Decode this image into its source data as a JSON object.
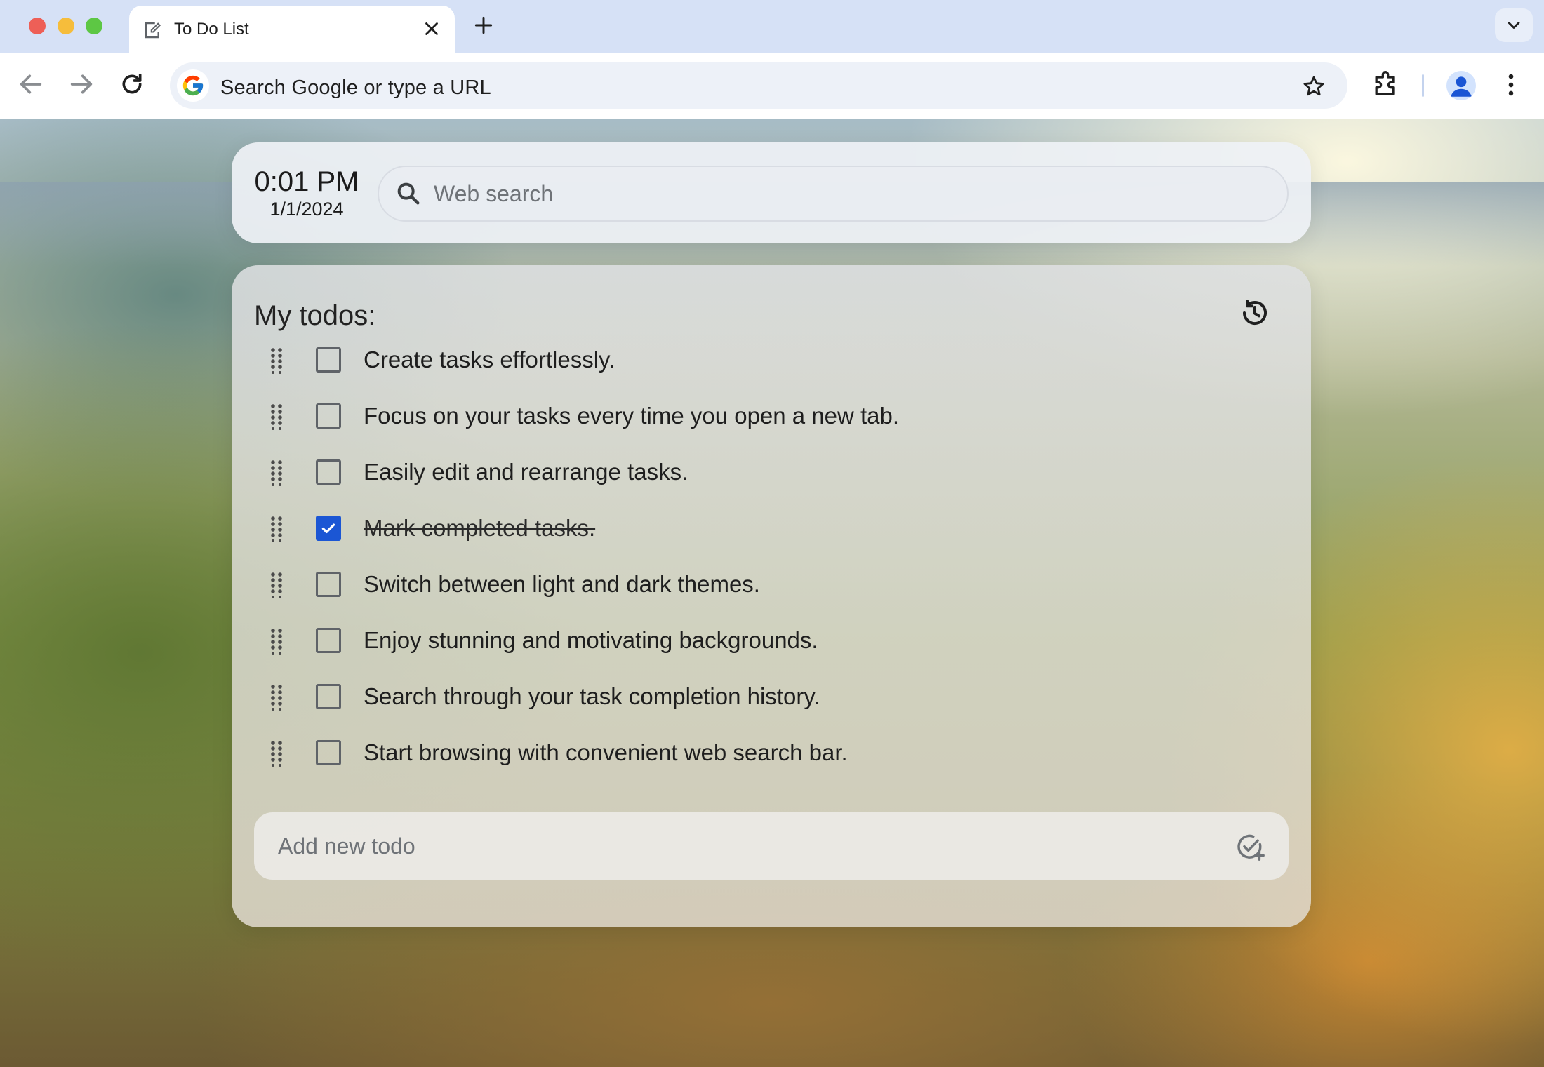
{
  "browser": {
    "tab_title": "To Do List",
    "omnibox_placeholder": "Search Google or type a URL"
  },
  "header": {
    "time": "0:01 PM",
    "date": "1/1/2024",
    "search_placeholder": "Web search"
  },
  "todos": {
    "title": "My todos:",
    "items": [
      {
        "text": "Create tasks effortlessly.",
        "done": false
      },
      {
        "text": "Focus on your tasks every time you open a new tab.",
        "done": false
      },
      {
        "text": "Easily edit and rearrange tasks.",
        "done": false
      },
      {
        "text": "Mark completed tasks.",
        "done": true
      },
      {
        "text": "Switch between light and dark themes.",
        "done": false
      },
      {
        "text": "Enjoy stunning and motivating backgrounds.",
        "done": false
      },
      {
        "text": "Search through your task completion history.",
        "done": false
      },
      {
        "text": "Start browsing with convenient web search bar.",
        "done": false
      }
    ],
    "add_placeholder": "Add new todo"
  },
  "colors": {
    "checkbox_checked": "#1b56d4",
    "tabstrip": "#d6e1f6"
  },
  "icons": [
    "edit-note-icon",
    "close-icon",
    "plus-icon",
    "chevron-down-icon",
    "back-arrow-icon",
    "forward-arrow-icon",
    "reload-icon",
    "google-logo-icon",
    "star-icon",
    "extensions-puzzle-icon",
    "profile-avatar-icon",
    "kebab-menu-icon",
    "search-icon",
    "history-icon",
    "drag-handle-icon",
    "checkmark-icon",
    "add-task-icon"
  ]
}
